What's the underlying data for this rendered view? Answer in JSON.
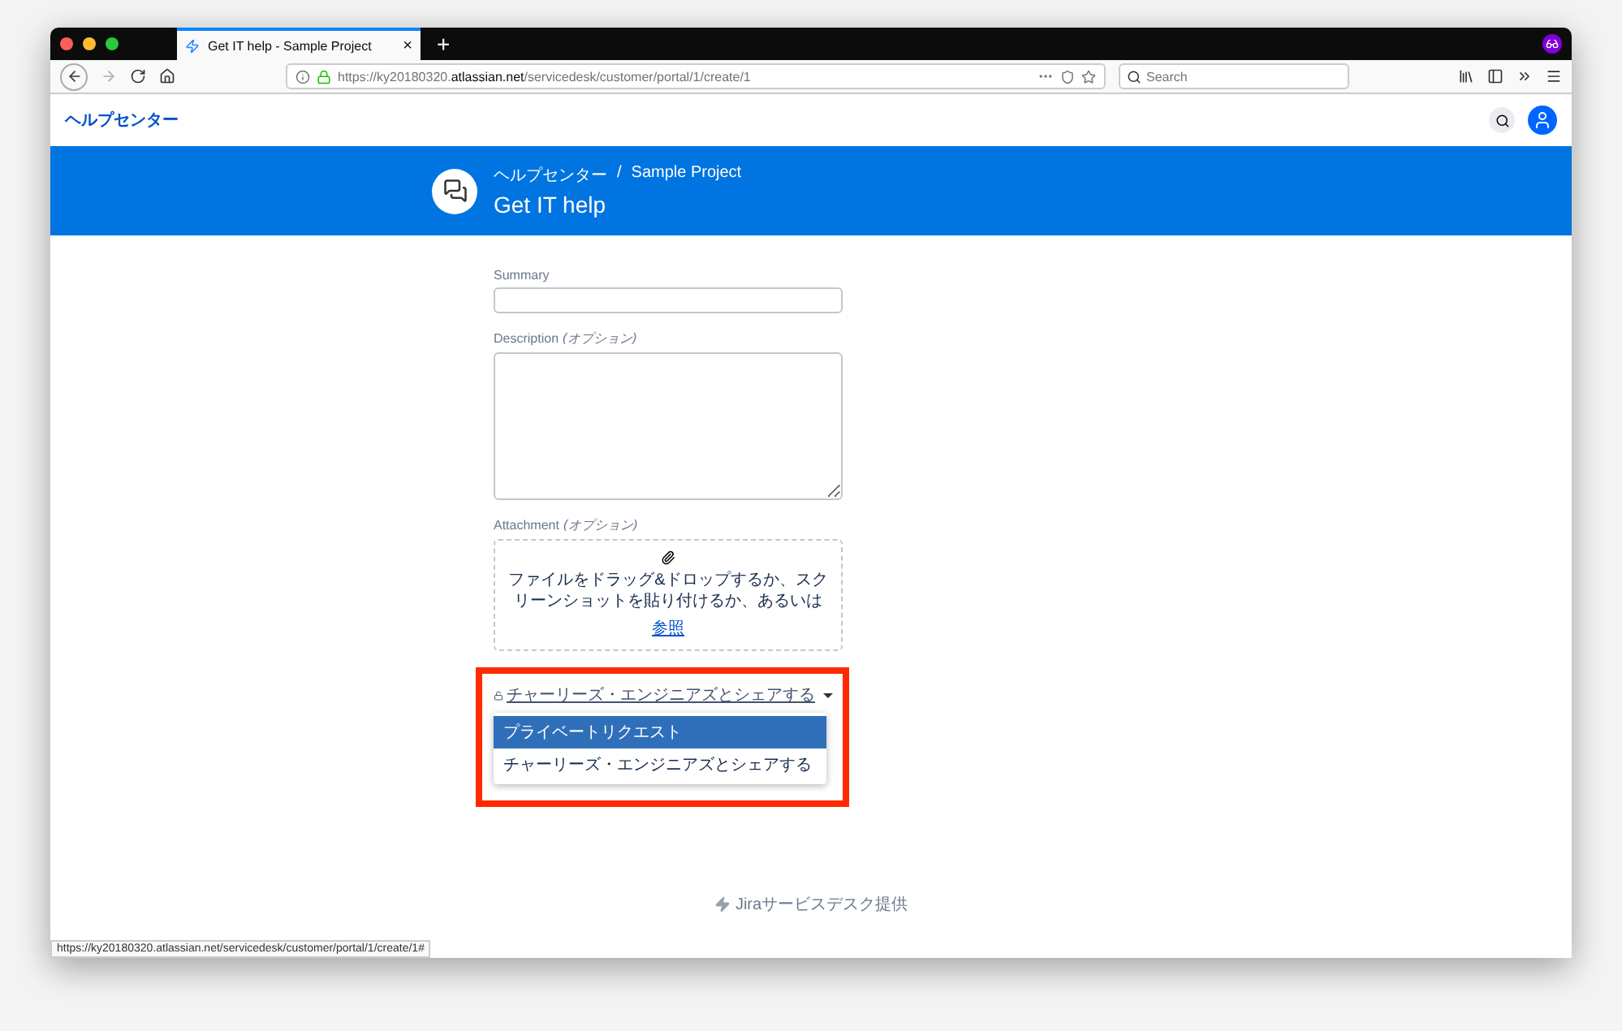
{
  "browser": {
    "tab": {
      "title": "Get IT help - Sample Project",
      "close": "×"
    },
    "new_tab": "+",
    "url": "https://ky20180320.**atlassian.net**/servicedesk/customer/portal/1/create/1",
    "search": {
      "placeholder": "Search"
    }
  },
  "header": {
    "home_link": "ヘルプセンター"
  },
  "banner": {
    "breadcrumb": [
      "ヘルプセンター",
      "Sample Project"
    ],
    "separator": "/",
    "title": "Get IT help"
  },
  "form": {
    "fields": [
      {
        "kind": "input",
        "label": "Summary"
      },
      {
        "kind": "textarea",
        "label": "Description",
        "optional": "(オプション)"
      },
      {
        "kind": "attachment",
        "label": "Attachment",
        "optional": "(オプション)",
        "prompt": "ファイルをドラッグ&ドロップするか、スクリーンショットを貼り付けるか、あるいは",
        "browse": "参照"
      }
    ],
    "sharing": {
      "value": "チャーリーズ・エンジニアズとシェアする",
      "menu": [
        {
          "label": "プライベートリクエスト",
          "highlighted": true
        },
        {
          "label": "チャーリーズ・エンジニアズとシェアする",
          "highlighted": false
        }
      ]
    }
  },
  "footer": "Jiraサービスデスク提供",
  "status_bar": "https://ky20180320.atlassian.net/servicedesk/customer/portal/1/create/1#"
}
